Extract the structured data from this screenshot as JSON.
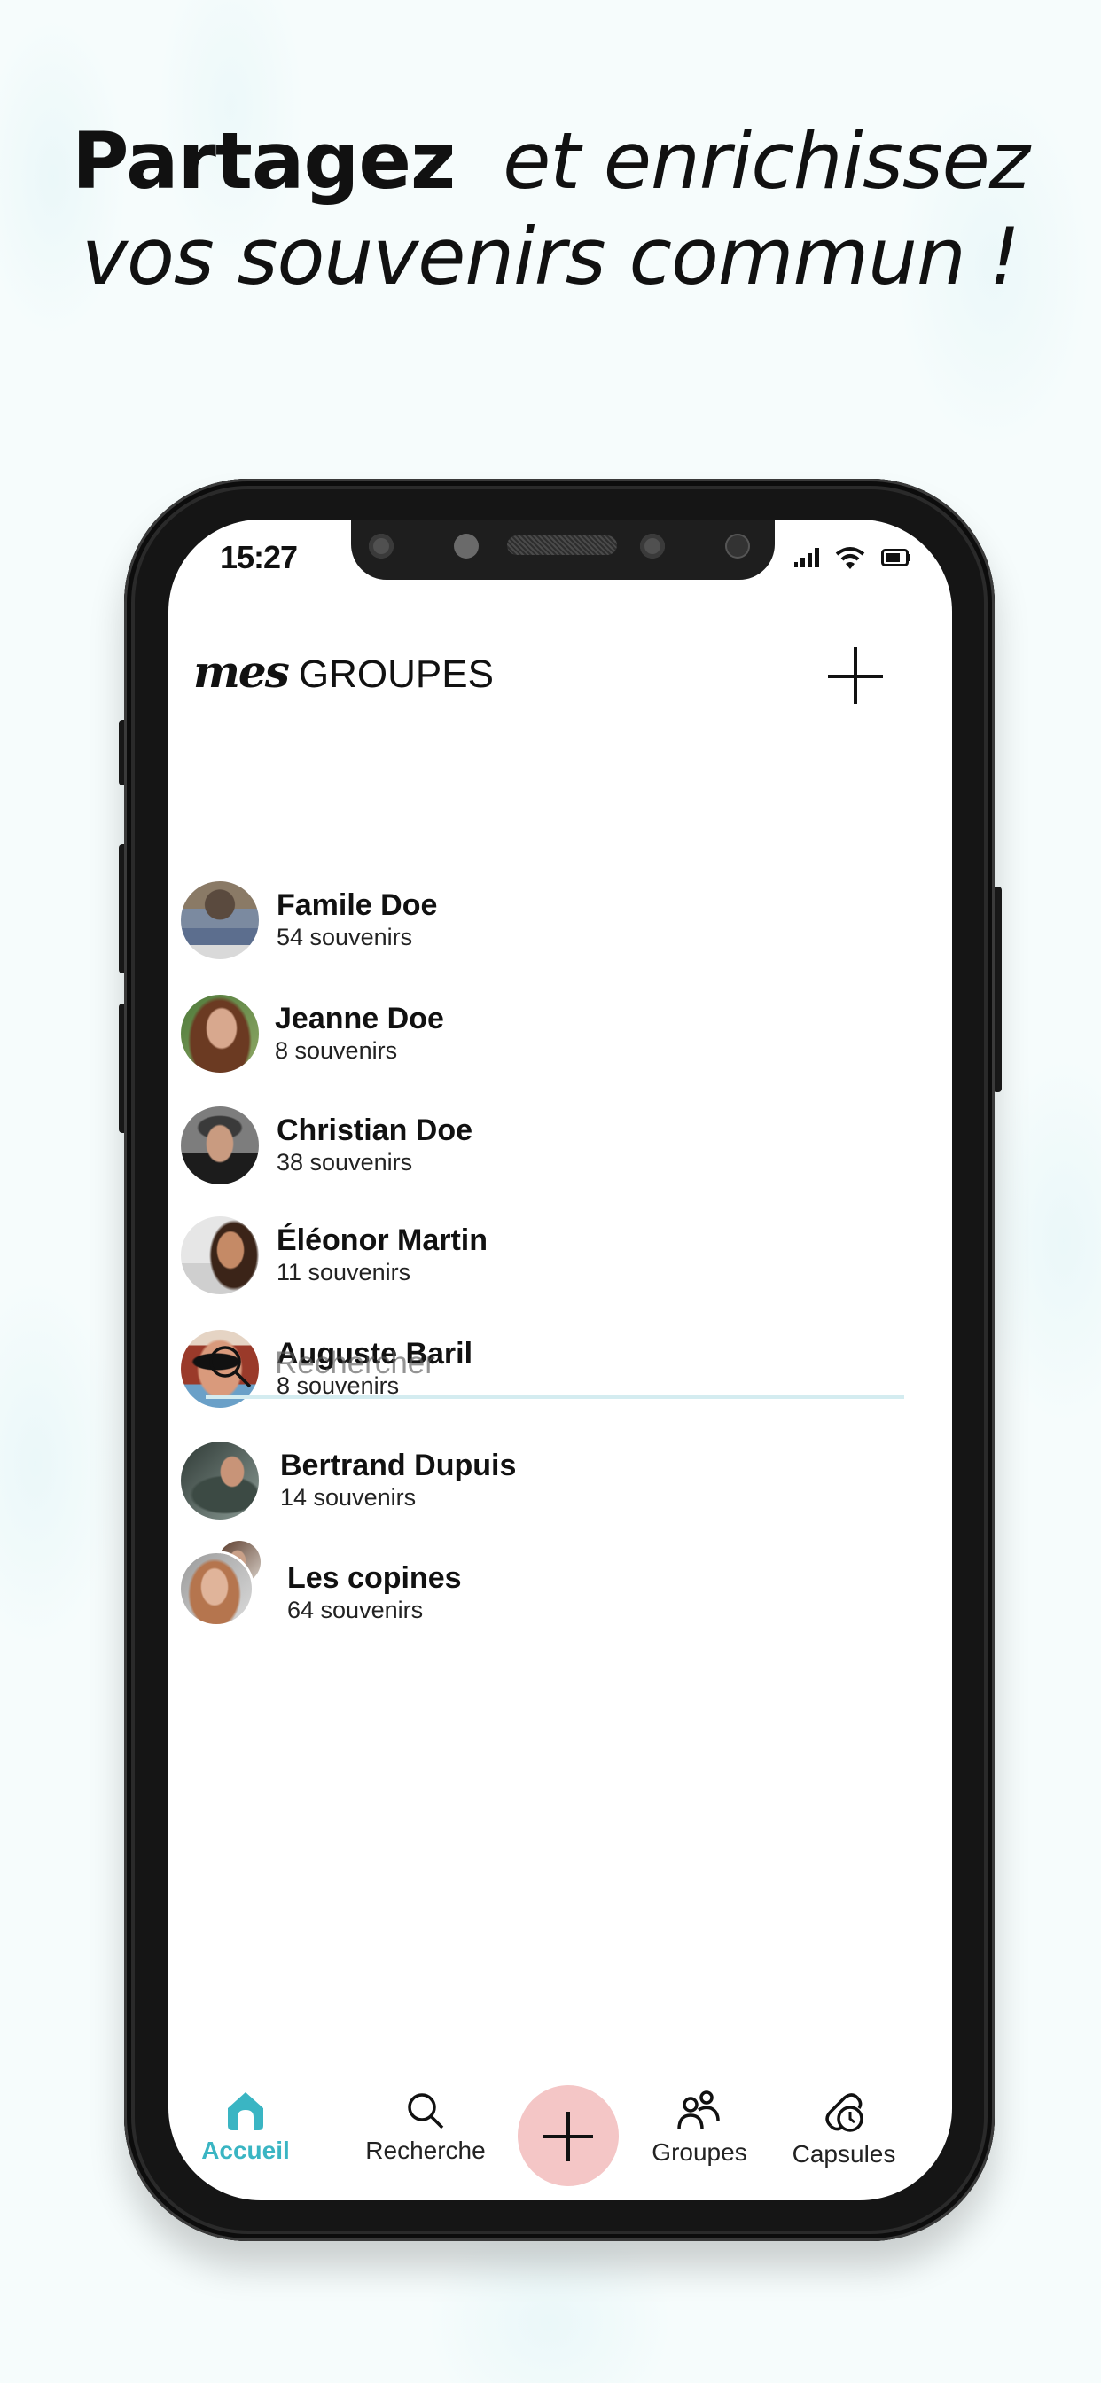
{
  "headline": {
    "bold": "Partagez",
    "italic_line1": "et enrichissez",
    "italic_line2": "vos souvenirs commun !"
  },
  "status_bar": {
    "time": "15:27",
    "icons": [
      "signal-icon",
      "wifi-icon",
      "battery-icon"
    ]
  },
  "header": {
    "logo_prefix": "mes",
    "title": "GROUPES",
    "add_button_icon": "plus-icon"
  },
  "groups": [
    {
      "name": "Famile Doe",
      "count": "54 souvenirs"
    },
    {
      "name": "Jeanne Doe",
      "count": "8 souvenirs"
    },
    {
      "name": "Christian Doe",
      "count": "38 souvenirs"
    },
    {
      "name": "Éléonor Martin",
      "count": "11 souvenirs"
    },
    {
      "name": "Auguste Baril",
      "count": "8 souvenirs"
    },
    {
      "name": "Bertrand Dupuis",
      "count": "14 souvenirs"
    },
    {
      "name": "Les copines",
      "count": "64 souvenirs"
    }
  ],
  "search": {
    "placeholder": "Rechercher",
    "icon": "search-icon"
  },
  "bottom_nav": {
    "items": [
      {
        "label": "Accueil",
        "icon": "home-icon",
        "active": true
      },
      {
        "label": "Recherche",
        "icon": "search-icon",
        "active": false
      },
      {
        "label": "Groupes",
        "icon": "users-icon",
        "active": false
      },
      {
        "label": "Capsules",
        "icon": "capsule-clock-icon",
        "active": false
      }
    ],
    "fab_icon": "plus-icon"
  },
  "colors": {
    "accent": "#3ab5c3",
    "fab": "#f4c6c6",
    "text": "#111111",
    "background": "#f6fcfc"
  }
}
